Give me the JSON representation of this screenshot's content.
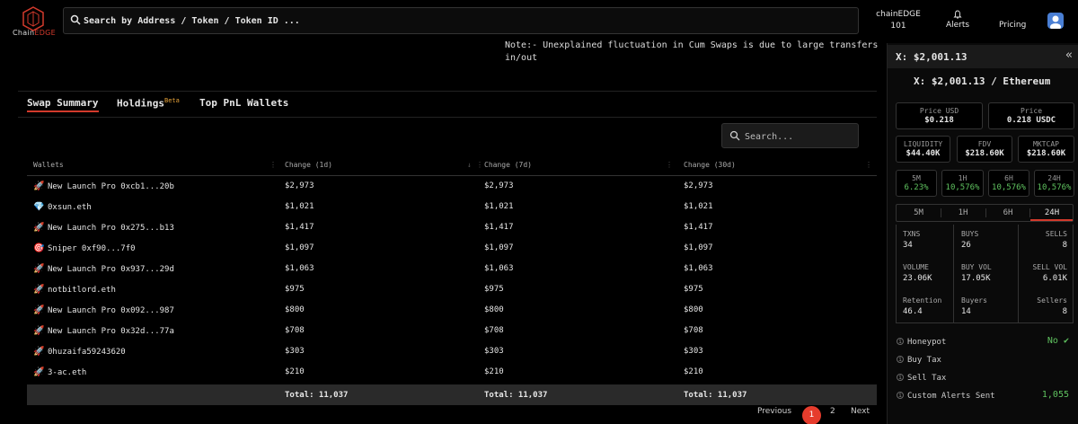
{
  "brand": {
    "name_part1": "Chain",
    "name_part2": "EDGE"
  },
  "search": {
    "placeholder": "Search by Address / Token / Token ID ..."
  },
  "chain": {
    "name": "chainEDGE",
    "number": "101"
  },
  "nav": {
    "alerts": "Alerts",
    "pricing": "Pricing"
  },
  "note": "Note:- Unexplained fluctuation in Cum Swaps is due to large transfers in/out",
  "tabs": [
    {
      "label": "Swap Summary",
      "badge": ""
    },
    {
      "label": "Holdings",
      "badge": "Beta"
    },
    {
      "label": "Top PnL Wallets",
      "badge": ""
    }
  ],
  "table_search": {
    "placeholder": "Search..."
  },
  "table": {
    "columns": [
      "Wallets",
      "Change (1d)",
      "Change (7d)",
      "Change (30d)"
    ],
    "rows": [
      {
        "icon": "rocket",
        "wallet": "New Launch Pro 0xcb1...20b",
        "d1": "$2,973",
        "d7": "$2,973",
        "d30": "$2,973"
      },
      {
        "icon": "diamond",
        "wallet": "0xsun.eth",
        "d1": "$1,021",
        "d7": "$1,021",
        "d30": "$1,021"
      },
      {
        "icon": "rocket",
        "wallet": "New Launch Pro 0x275...b13",
        "d1": "$1,417",
        "d7": "$1,417",
        "d30": "$1,417"
      },
      {
        "icon": "target",
        "wallet": "Sniper 0xf90...7f0",
        "d1": "$1,097",
        "d7": "$1,097",
        "d30": "$1,097"
      },
      {
        "icon": "rocket",
        "wallet": "New Launch Pro 0x937...29d",
        "d1": "$1,063",
        "d7": "$1,063",
        "d30": "$1,063"
      },
      {
        "icon": "rocket",
        "wallet": "notbitlord.eth",
        "d1": "$975",
        "d7": "$975",
        "d30": "$975"
      },
      {
        "icon": "rocket",
        "wallet": "New Launch Pro 0x092...987",
        "d1": "$800",
        "d7": "$800",
        "d30": "$800"
      },
      {
        "icon": "rocket",
        "wallet": "New Launch Pro 0x32d...77a",
        "d1": "$708",
        "d7": "$708",
        "d30": "$708"
      },
      {
        "icon": "rocket",
        "wallet": "0huzaifa59243620",
        "d1": "$303",
        "d7": "$303",
        "d30": "$303"
      },
      {
        "icon": "rocket",
        "wallet": "3-ac.eth",
        "d1": "$210",
        "d7": "$210",
        "d30": "$210"
      }
    ],
    "totals": {
      "d1": "Total: 11,037",
      "d7": "Total: 11,037",
      "d30": "Total: 11,037"
    }
  },
  "pagination": {
    "previous": "Previous",
    "pages": [
      "1",
      "2"
    ],
    "current": "1",
    "next": "Next"
  },
  "panel": {
    "header": "X: $2,001.13",
    "pair": "X: $2,001.13 / Ethereum",
    "price_usd": {
      "label": "Price USD",
      "value": "$0.218"
    },
    "price": {
      "label": "Price",
      "value": "0.218 USDC"
    },
    "liquidity": {
      "label": "LIQUIDITY",
      "value": "$44.40K"
    },
    "fdv": {
      "label": "FDV",
      "value": "$218.60K"
    },
    "mktcap": {
      "label": "MKTCAP",
      "value": "$218.60K"
    },
    "changes": [
      {
        "label": "5M",
        "value": "6.23%"
      },
      {
        "label": "1H",
        "value": "10,576%"
      },
      {
        "label": "6H",
        "value": "10,576%"
      },
      {
        "label": "24H",
        "value": "10,576%"
      }
    ],
    "time_tabs": [
      "5M",
      "1H",
      "6H",
      "24H"
    ],
    "active_tab": "24H",
    "stats": {
      "txns": {
        "label": "TXNS",
        "value": "34"
      },
      "buys": {
        "label": "BUYS",
        "value": "26"
      },
      "sells": {
        "label": "SELLS",
        "value": "8"
      },
      "volume": {
        "label": "VOLUME",
        "value": "23.06K"
      },
      "buy_vol": {
        "label": "BUY VOL",
        "value": "17.05K"
      },
      "sell_vol": {
        "label": "SELL VOL",
        "value": "6.01K"
      },
      "retention": {
        "label": "Retention",
        "value": "46.4"
      },
      "buyers": {
        "label": "Buyers",
        "value": "14"
      },
      "sellers": {
        "label": "Sellers",
        "value": "8"
      }
    },
    "honeypot": {
      "label": "Honeypot",
      "value": "No"
    },
    "buy_tax": {
      "label": "Buy Tax"
    },
    "sell_tax": {
      "label": "Sell Tax"
    },
    "custom_alerts": {
      "label": "Custom Alerts Sent",
      "value": "1,055"
    }
  },
  "colors": {
    "accent": "#d33a2c",
    "green": "#5fc25f",
    "beta": "#e8a43a"
  }
}
